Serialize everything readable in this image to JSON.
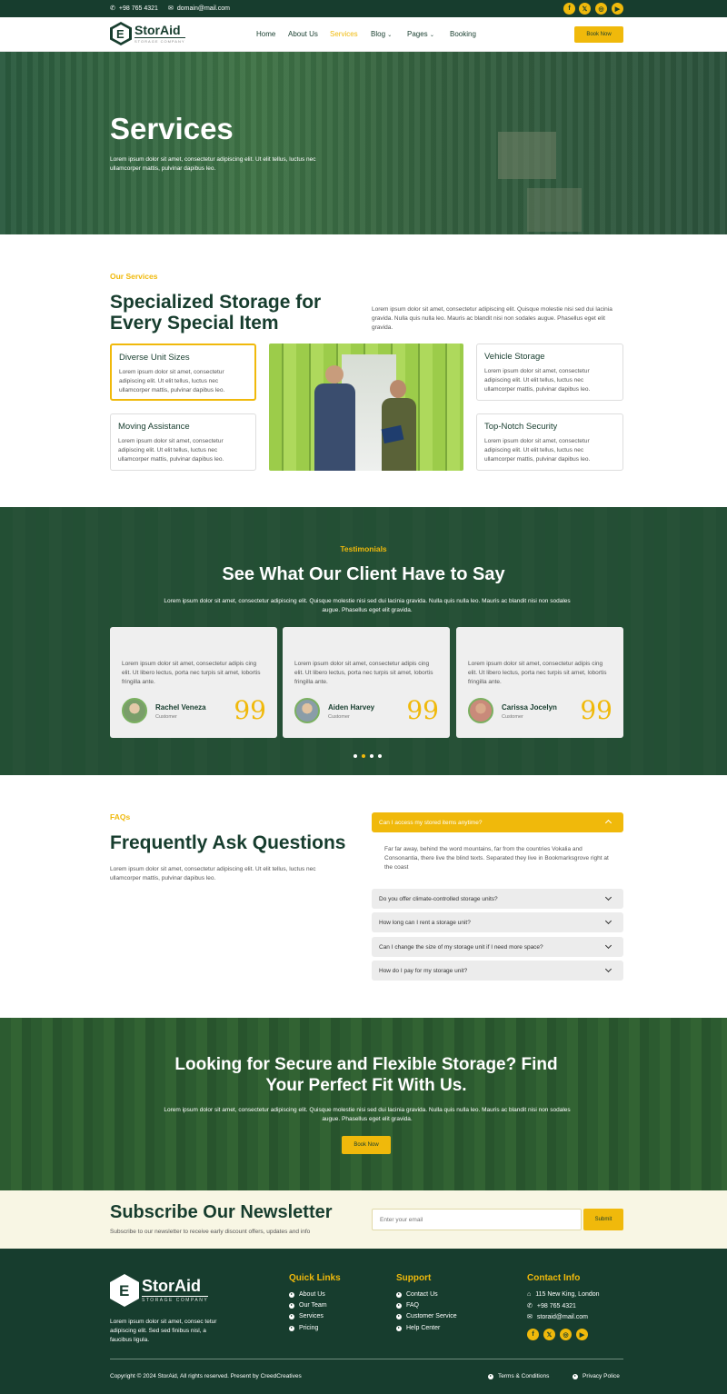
{
  "topbar": {
    "phone": "+98 765 4321",
    "email": "domain@mail.com"
  },
  "brand": {
    "name": "StorAid",
    "tagline": "STORAGE COMPANY"
  },
  "nav": {
    "items": [
      "Home",
      "About Us",
      "Services",
      "Blog",
      "Pages",
      "Booking"
    ],
    "active": "Services",
    "book_label": "Book Now"
  },
  "hero": {
    "title": "Services",
    "text": "Lorem ipsum dolor sit amet, consectetur adipiscing elit. Ut elit tellus, luctus nec ullamcorper mattis, pulvinar dapibus leo."
  },
  "services": {
    "eyebrow": "Our Services",
    "title": "Specialized Storage for Every Special Item",
    "intro": "Lorem ipsum dolor sit amet, consectetur adipiscing elit. Quisque molestie nisi sed dui lacinia gravida. Nulla quis nulla leo. Mauris ac blandit nisi non sodales augue. Phasellus eget elit gravida.",
    "cards": [
      {
        "title": "Diverse Unit Sizes",
        "text": "Lorem ipsum dolor sit amet, consectetur adipiscing elit. Ut elit tellus, luctus nec ullamcorper mattis, pulvinar dapibus leo."
      },
      {
        "title": "Vehicle Storage",
        "text": "Lorem ipsum dolor sit amet, consectetur adipiscing elit. Ut elit tellus, luctus nec ullamcorper mattis, pulvinar dapibus leo."
      },
      {
        "title": "Moving Assistance",
        "text": "Lorem ipsum dolor sit amet, consectetur adipiscing elit. Ut elit tellus, luctus nec ullamcorper mattis, pulvinar dapibus leo."
      },
      {
        "title": "Top-Notch Security",
        "text": "Lorem ipsum dolor sit amet, consectetur adipiscing elit. Ut elit tellus, luctus nec ullamcorper mattis, pulvinar dapibus leo."
      }
    ]
  },
  "testimonials": {
    "eyebrow": "Testimonials",
    "title": "See What Our Client Have to Say",
    "text": "Lorem ipsum dolor sit amet, consectetur adipiscing elit. Quisque molestie nisi sed dui lacinia gravida. Nulla quis nulla leo. Mauris ac blandit nisi non sodales augue. Phasellus eget elit gravida.",
    "items": [
      {
        "quote": "Lorem ipsum dolor sit amet, consectetur adipis cing elit. Ut libero lectus, porta nec turpis sit amet, lobortis fringilla ante.",
        "name": "Rachel Veneza",
        "role": "Customer"
      },
      {
        "quote": "Lorem ipsum dolor sit amet, consectetur adipis cing elit. Ut libero lectus, porta nec turpis sit amet, lobortis fringilla ante.",
        "name": "Aiden Harvey",
        "role": "Customer"
      },
      {
        "quote": "Lorem ipsum dolor sit amet, consectetur adipis cing elit. Ut libero lectus, porta nec turpis sit amet, lobortis fringilla ante.",
        "name": "Carissa Jocelyn",
        "role": "Customer"
      }
    ],
    "quote_mark": "99"
  },
  "faq": {
    "eyebrow": "FAQs",
    "title": "Frequently Ask Questions",
    "text": "Lorem ipsum dolor sit amet, consectetur adipiscing elit. Ut elit tellus, luctus nec ullamcorper mattis, pulvinar dapibus leo.",
    "open_question": "Can I access my stored items anytime?",
    "open_answer": "Far far away, behind the word mountains, far from the countries Vokalia and Consonantia, there live the blind texts. Separated they live in Bookmarksgrove right at the coast",
    "questions": [
      "Do you offer climate-controlled storage units?",
      "How long can I rent a storage unit?",
      "Can I change the size of my storage unit if I need more space?",
      "How do I pay for my storage unit?"
    ]
  },
  "cta": {
    "title": "Looking for Secure and Flexible Storage? Find Your Perfect Fit With Us.",
    "text": "Lorem ipsum dolor sit amet, consectetur adipiscing elit. Quisque molestie nisi sed dui lacinia gravida. Nulla quis nulla leo. Mauris ac blandit nisi non sodales augue. Phasellus eget elit gravida.",
    "button": "Book Now"
  },
  "newsletter": {
    "title": "Subscribe Our Newsletter",
    "text": "Subscribe to our newsletter to receive early discount offers, updates and info",
    "placeholder": "Enter your email",
    "button": "Submit"
  },
  "footer": {
    "about": "Lorem ipsum dolor sit amet, consec tetur adipiscing elit. Sed sed finibus nisl, a faucibus ligula.",
    "quick_title": "Quick Links",
    "quick": [
      "About Us",
      "Our Team",
      "Services",
      "Pricing"
    ],
    "support_title": "Support",
    "support": [
      "Contact Us",
      "FAQ",
      "Customer Service",
      "Help Center"
    ],
    "contact_title": "Contact Info",
    "address": "115 New King, London",
    "phone": "+98 765 4321",
    "email": "storaid@mail.com",
    "copyright": "Copyright © 2024 StorAid, All rights reserved. Present by CreedCreatives",
    "terms": "Terms & Conditions",
    "privacy": "Privacy Police"
  },
  "colors": {
    "primary": "#173d2e",
    "accent": "#f0b90b"
  }
}
